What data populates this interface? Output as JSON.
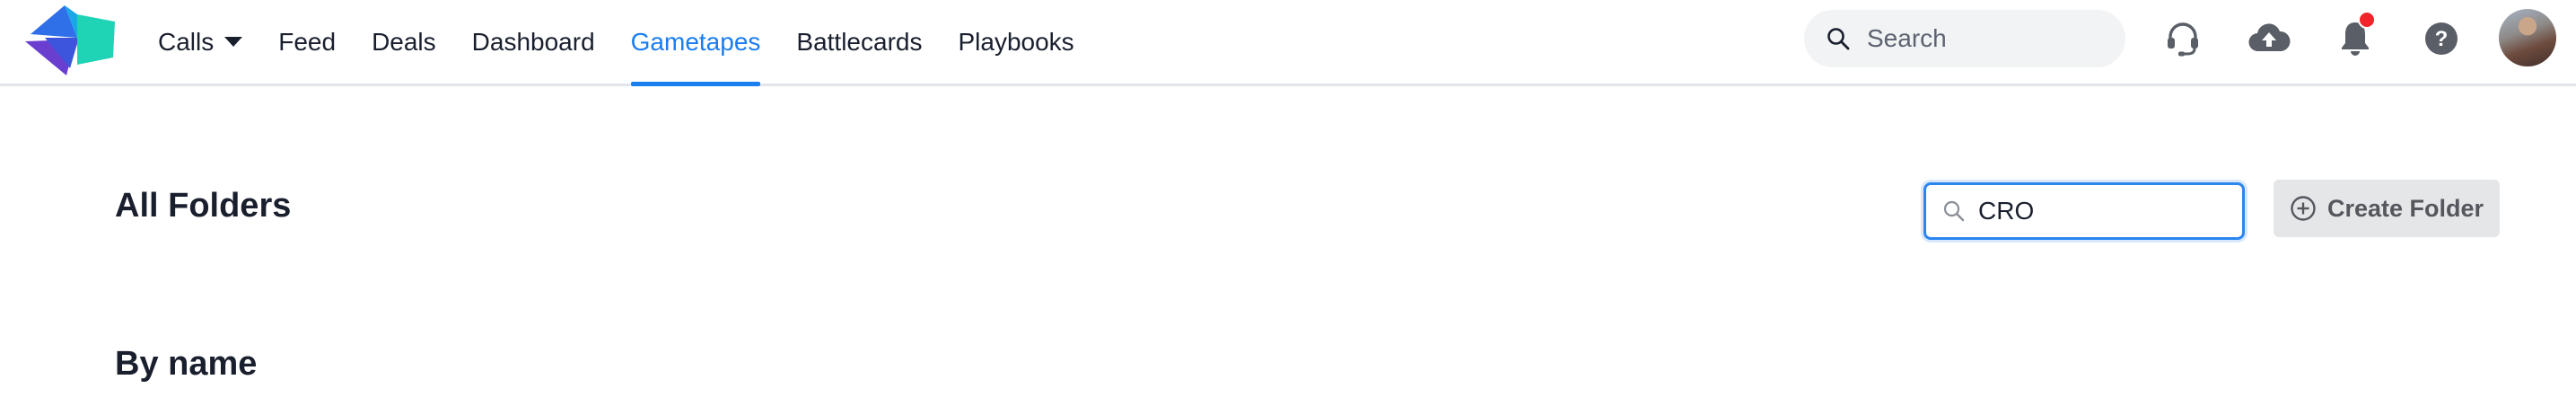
{
  "topbar": {
    "logo_icon": "gong-logo-icon",
    "nav": [
      {
        "label": "Calls",
        "has_dropdown": true,
        "active": false
      },
      {
        "label": "Feed",
        "active": false
      },
      {
        "label": "Deals",
        "active": false
      },
      {
        "label": "Dashboard",
        "active": false
      },
      {
        "label": "Gametapes",
        "active": true
      },
      {
        "label": "Battlecards",
        "active": false
      },
      {
        "label": "Playbooks",
        "active": false
      }
    ],
    "search": {
      "placeholder": "Search",
      "icon": "search-icon"
    },
    "icons": [
      "headset-icon",
      "cloud-upload-icon",
      "bell-icon",
      "help-icon"
    ],
    "notification_dot": true,
    "avatar": "user-avatar"
  },
  "main": {
    "title": "All Folders",
    "folder_search": {
      "value": "CRO",
      "icon": "search-icon"
    },
    "create_folder_label": "Create Folder",
    "create_folder_icon": "plus-circle-icon",
    "section_title": "By name"
  },
  "colors": {
    "accent": "#1a7df0",
    "notification": "#f0242b",
    "logo_blue": "#2f6fe8",
    "logo_teal": "#1fd3b5",
    "logo_purple": "#6a3fd0"
  }
}
